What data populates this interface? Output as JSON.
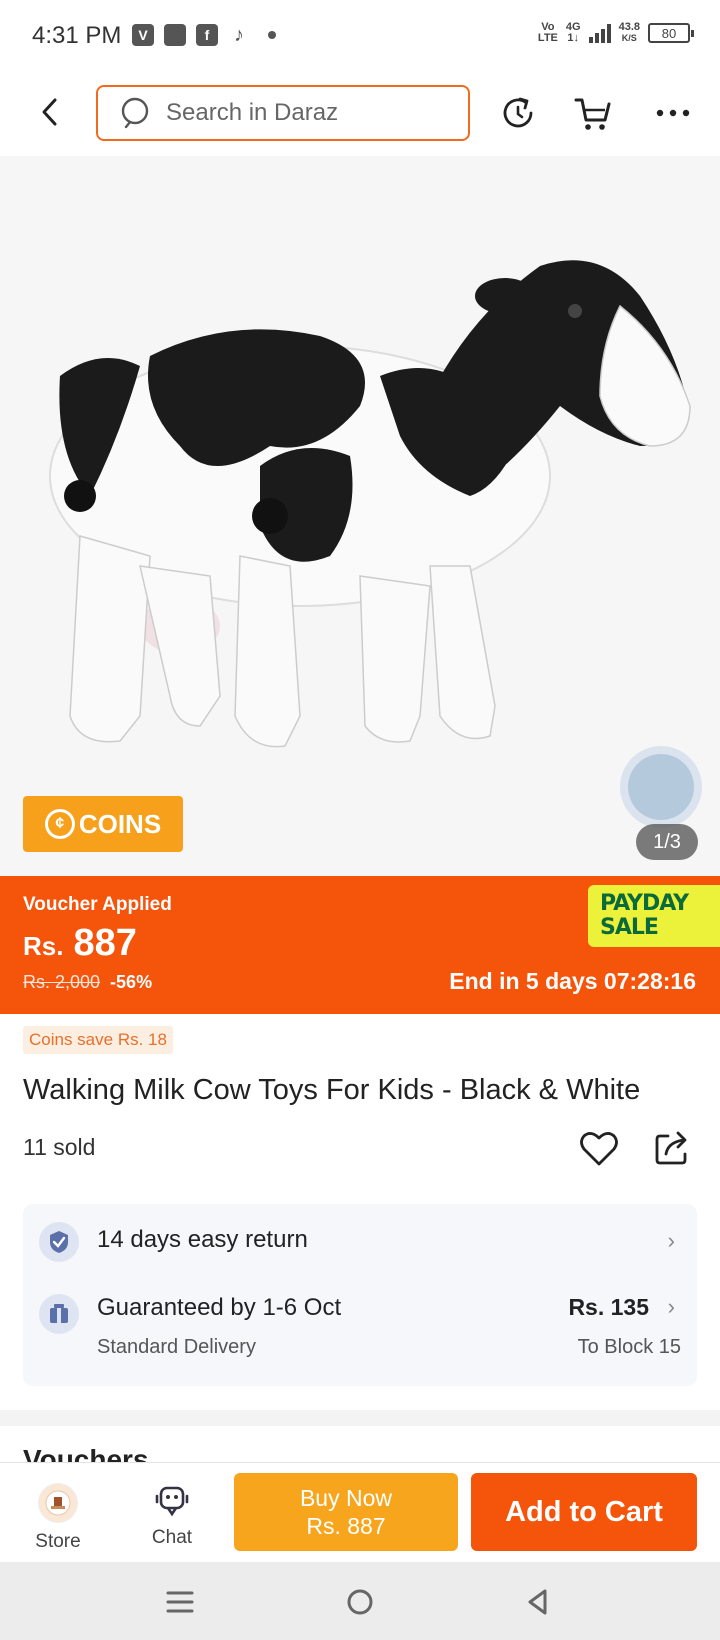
{
  "status_bar": {
    "time": "4:31 PM",
    "apps": [
      "V",
      "",
      "f",
      "♪"
    ],
    "volte": [
      "Vo",
      "LTE"
    ],
    "network": [
      "4G",
      "1↓"
    ],
    "speed": [
      "43.8",
      "K/S"
    ],
    "battery": "80"
  },
  "top_bar": {
    "search_placeholder": "Search in Daraz"
  },
  "gallery": {
    "coins_label": "COINS",
    "counter": "1/3"
  },
  "price": {
    "voucher_label": "Voucher Applied",
    "currency": "Rs.",
    "current": "887",
    "original": "Rs. 2,000",
    "discount": "-56%",
    "sale_line1": "PAYDAY",
    "sale_line2": "SALE",
    "countdown": "End in 5 days 07:28:16"
  },
  "product": {
    "coins_save": "Coins save Rs. 18",
    "title": "Walking Milk Cow Toys For Kids - Black & White",
    "sold": "11 sold"
  },
  "services": {
    "return_text": "14 days easy return",
    "delivery_text": "Guaranteed by 1-6 Oct",
    "delivery_type": "Standard Delivery",
    "delivery_price": "Rs. 135",
    "delivery_location": "To Block 15"
  },
  "vouchers_peek": "Vouchers",
  "bottom_bar": {
    "store_label": "Store",
    "chat_label": "Chat",
    "buy_now_label": "Buy Now",
    "buy_now_price": "Rs. 887",
    "add_to_cart_label": "Add to Cart"
  },
  "colors": {
    "brand_orange": "#f5540b",
    "buy_now_yellow": "#f7a51d",
    "payday_yellow": "#ecf23a"
  }
}
